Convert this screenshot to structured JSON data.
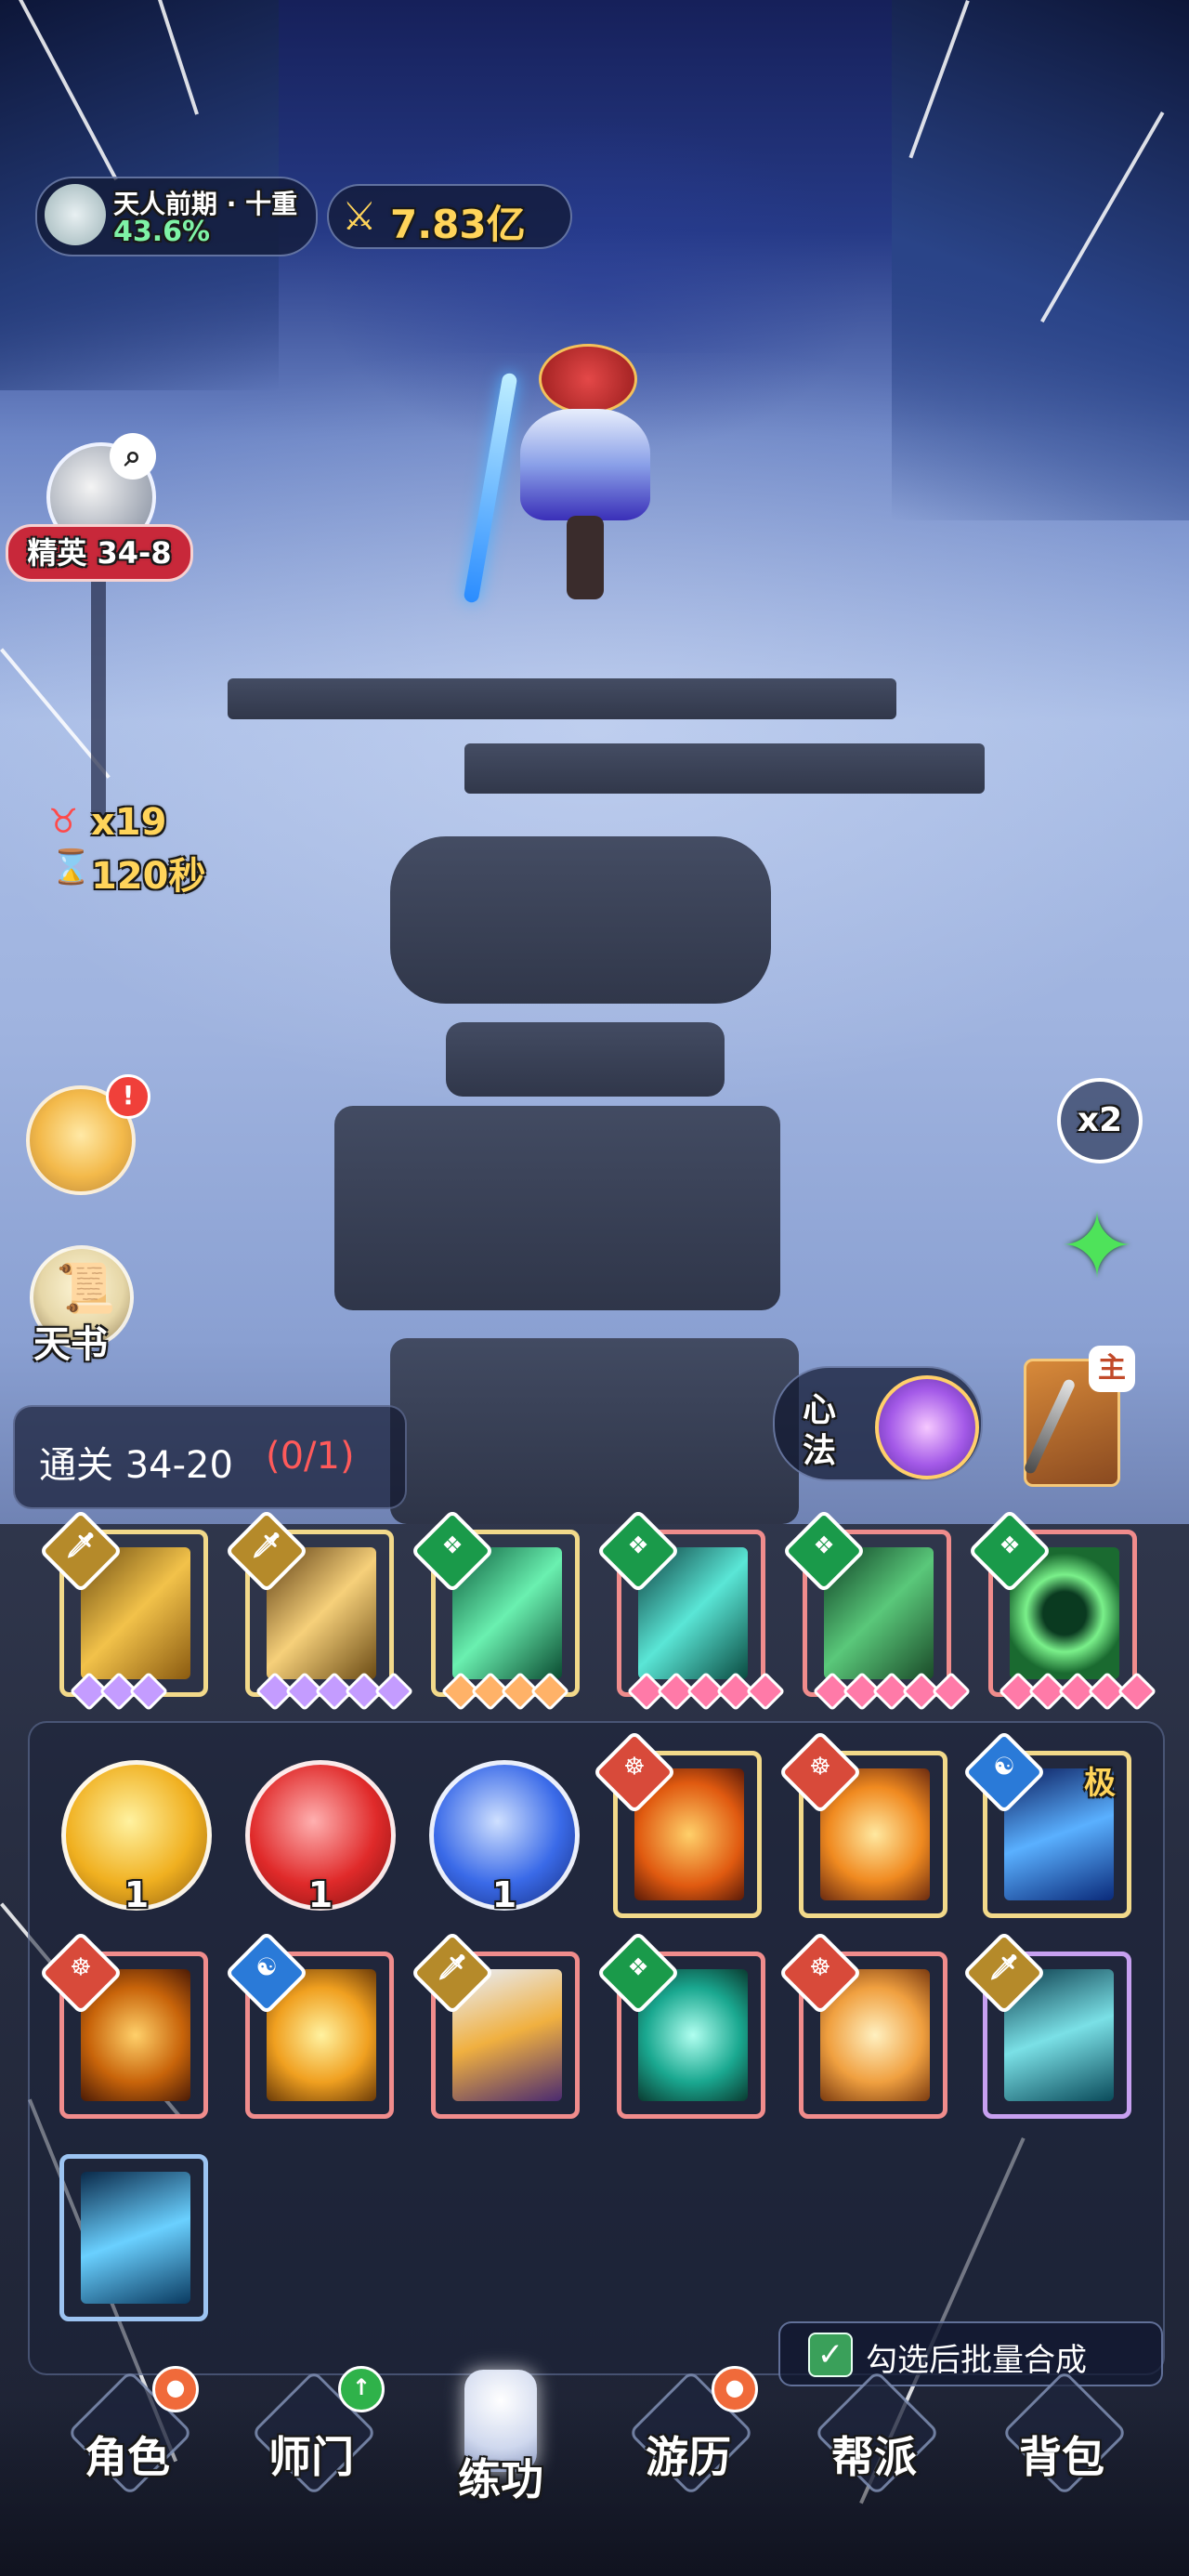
{
  "player": {
    "realm": "天人前期 · 十重",
    "progress": "43.6%",
    "power": "7.83亿"
  },
  "stage": {
    "label": "精英 34-8",
    "enemy_count": "x19",
    "timer": "120秒"
  },
  "side_buttons": {
    "book_label": "天书",
    "speed_label": "x2",
    "alert_mark": "!"
  },
  "quest": {
    "prefix": "通关 34-20",
    "progress": "(0/1)"
  },
  "xinfa": {
    "label_top": "心",
    "label_bottom": "法"
  },
  "weapon_badge": "主",
  "equipped_skills": [
    {
      "badge": "sword",
      "gems": 3,
      "gem_color": "#c49cff"
    },
    {
      "badge": "sword",
      "gems": 5,
      "gem_color": "#c49cff"
    },
    {
      "badge": "leaf",
      "gems": 4,
      "gem_color": "#ffb268"
    },
    {
      "badge": "leaf",
      "gems": 5,
      "gem_color": "#ff7aa8"
    },
    {
      "badge": "leaf",
      "gems": 5,
      "gem_color": "#ff7aa8"
    },
    {
      "badge": "leaf",
      "gems": 5,
      "gem_color": "#ff7aa8"
    }
  ],
  "orbs": [
    {
      "color": "gold",
      "count": "1"
    },
    {
      "color": "red",
      "count": "1"
    },
    {
      "color": "blue",
      "count": "1"
    }
  ],
  "inventory_tag": "极",
  "batch_merge": {
    "label": "勾选后批量合成",
    "checked": true
  },
  "nav": {
    "role": "角色",
    "school": "师门",
    "train": "练功",
    "travel": "游历",
    "guild": "帮派",
    "bag": "背包"
  },
  "colors": {
    "gold_text": "#ffd45a",
    "green_text": "#7ef2a6",
    "stage_red": "#c8283a",
    "quest_red": "#ff5a5a"
  }
}
